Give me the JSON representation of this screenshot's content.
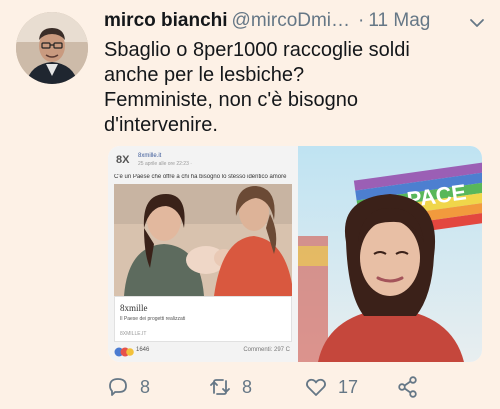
{
  "tweet": {
    "author_name": "mirco bianchi",
    "handle": "@mircoDmi…",
    "separator": "·",
    "date": "11 Mag",
    "text_lines": [
      "Sbaglio o 8per1000 raccoglie soldi",
      "anche per le lesbiche?",
      "Femministe, non c'è bisogno",
      "d'intervenire."
    ]
  },
  "embedded_post": {
    "page_name": "8xmille.it",
    "logo_text": "8X",
    "timestamp": "25 aprile alle ore 22:23 · ",
    "body": "C'è un Paese che offre a chi ha bisogno lo stesso identico amore",
    "link_title": "8xmille",
    "link_desc": "Il Paese dei progetti realizzati",
    "link_url": "8XMILLE.IT",
    "reaction_count": "1646",
    "comments": "Commenti: 297  C"
  },
  "right_image": {
    "banner_text": "PACE"
  },
  "actions": {
    "reply_count": "8",
    "retweet_count": "8",
    "like_count": "17"
  },
  "icons": {
    "reply": "reply-icon",
    "retweet": "retweet-icon",
    "like": "heart-icon",
    "share": "share-icon",
    "chevron": "chevron-down-icon"
  },
  "colors": {
    "background": "#fdf1e6",
    "text": "#14171a",
    "muted": "#657786"
  }
}
